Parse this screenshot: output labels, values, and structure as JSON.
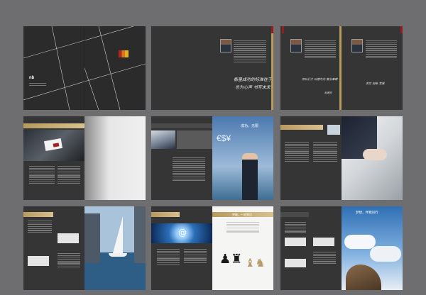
{
  "background_color": "#6e6e70",
  "spreads": [
    {
      "id": "s1",
      "kind": "cover"
    },
    {
      "id": "s2",
      "kind": "message",
      "signature": "衡量成功的标准在于坚持",
      "signature_line2": "言为心声 书写未来"
    },
    {
      "id": "s3",
      "kind": "message2",
      "signature": "何以汇才 以德为先 敬业奉献",
      "signature_name": "赵德志",
      "signature_right": "求实 创新 发展"
    },
    {
      "id": "s4",
      "kind": "card",
      "logo_text": "nb"
    },
    {
      "id": "s5",
      "kind": "binocular",
      "headline": "成功，无限"
    },
    {
      "id": "s6",
      "kind": "handshake"
    },
    {
      "id": "s7",
      "kind": "sailboat"
    },
    {
      "id": "s8",
      "kind": "chess",
      "headline": "突破，一站到达"
    },
    {
      "id": "s9",
      "kind": "clouds",
      "headline": "梦想，伴我同行"
    }
  ]
}
